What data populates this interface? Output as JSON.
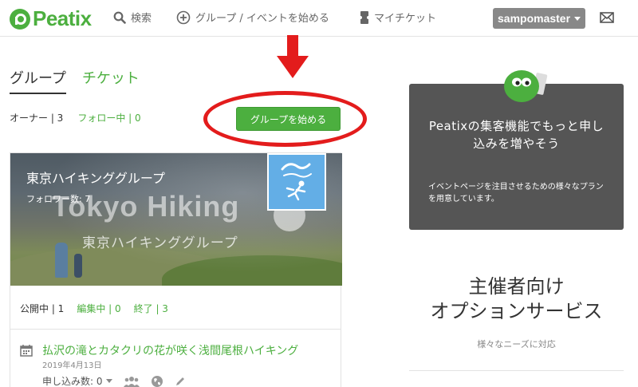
{
  "header": {
    "logo_text": "Peatix",
    "search_label": "検索",
    "start_group_label": "グループ / イベントを始める",
    "my_ticket_label": "マイチケット",
    "username": "sampomaster"
  },
  "tabs": [
    {
      "label": "グループ",
      "active": true
    },
    {
      "label": "チケット",
      "active": false
    }
  ],
  "stats": {
    "owner": "オーナー | 3",
    "following": "フォロー中 | 0"
  },
  "start_group_button": "グループを始める",
  "group": {
    "title": "東京ハイキンググループ",
    "followers": "フォロワー数: 7",
    "banner_text": "Tokyo Hiking",
    "banner_subtext": "東京ハイキンググループ",
    "status": {
      "published": "公開中 | 1",
      "editing": "編集中 | 0",
      "ended": "終了 | 3"
    }
  },
  "event": {
    "title": "払沢の滝とカタクリの花が咲く浅間尾根ハイキング",
    "date": "2019年4月13日",
    "applications": "申し込み数: 0"
  },
  "promo": {
    "title": "Peatixの集客機能でもっと申し込みを増やそう",
    "description": "イベントページを注目させるための様々なプランを用意しています。"
  },
  "service": {
    "title_line1": "主催者向け",
    "title_line2": "オプションサービス",
    "description": "様々なニーズに対応"
  },
  "colors": {
    "brand_green": "#4caf3f",
    "annotation_red": "#e31c1c",
    "promo_bg": "#555555"
  }
}
